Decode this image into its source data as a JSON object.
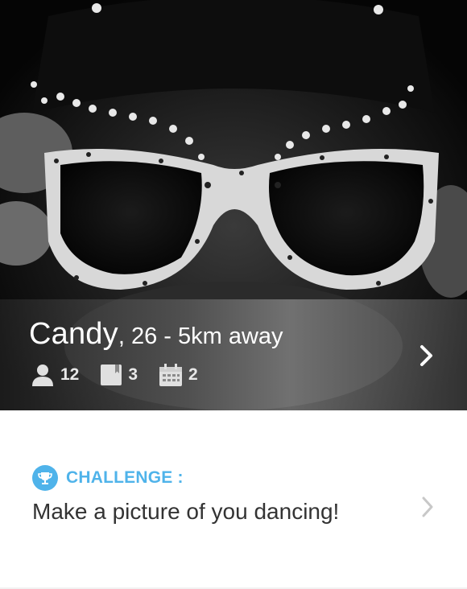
{
  "profile": {
    "name": "Candy",
    "details": ", 26 - 5km away",
    "stats": [
      {
        "icon": "person-icon",
        "value": "12"
      },
      {
        "icon": "book-icon",
        "value": "3"
      },
      {
        "icon": "calendar-icon",
        "value": "2"
      }
    ]
  },
  "challenge": {
    "label": "CHALLENGE :",
    "text": "Make a picture of you dancing!"
  },
  "colors": {
    "accent": "#4fb3ea",
    "overlay_text": "#ffffff",
    "body_text": "#333333",
    "chevron_light": "#c8c8c8"
  }
}
